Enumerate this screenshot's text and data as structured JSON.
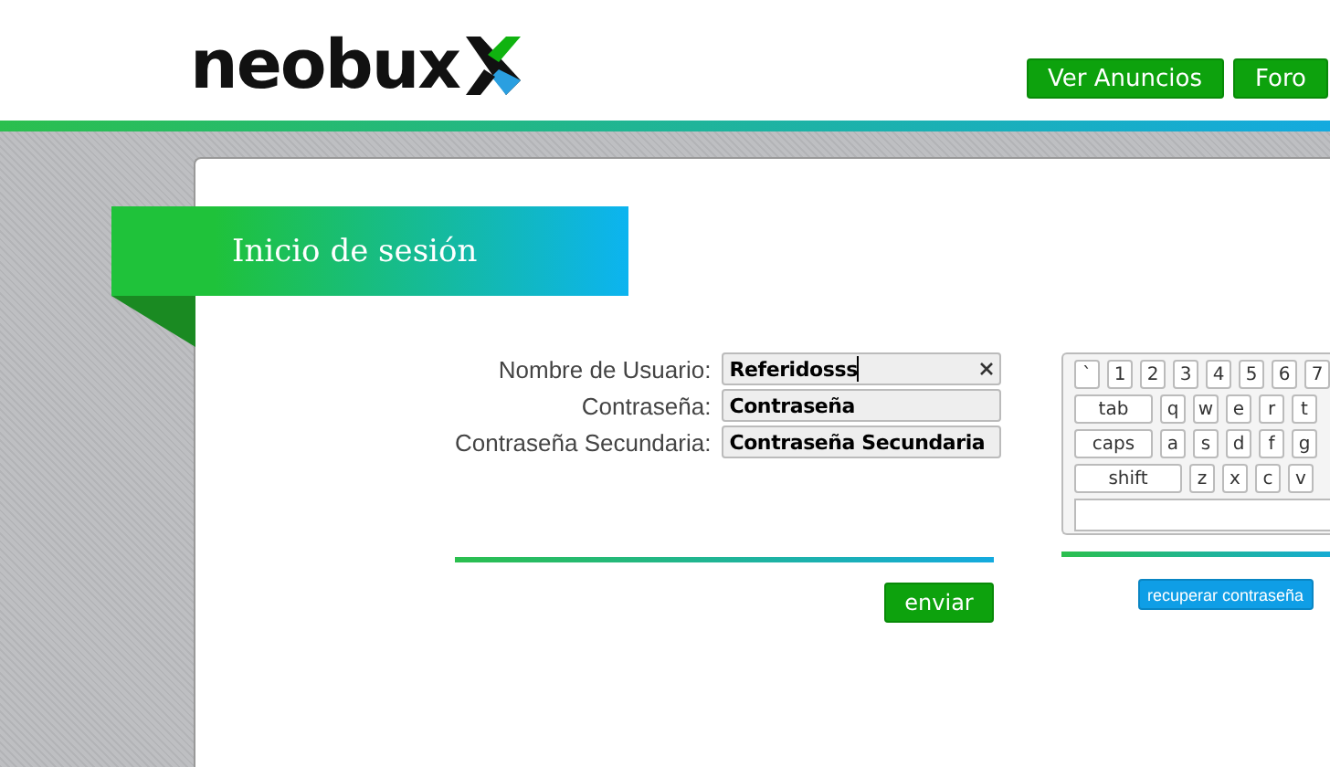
{
  "header": {
    "logo": "neobux",
    "nav": [
      "Ver Anuncios",
      "Foro"
    ]
  },
  "login": {
    "title": "Inicio de sesión",
    "fields": [
      {
        "label": "Nombre de Usuario:",
        "value": "Referidosss",
        "clearable": true
      },
      {
        "label": "Contraseña:",
        "value": "Contraseña",
        "clearable": false
      },
      {
        "label": "Contraseña Secundaria:",
        "value": "Contraseña Secundaria",
        "clearable": false
      }
    ],
    "submit": "enviar"
  },
  "keyboard": {
    "key_rows": [
      [
        {
          "label": "`",
          "kind": "key"
        },
        {
          "label": "1",
          "kind": "key"
        },
        {
          "label": "2",
          "kind": "key"
        },
        {
          "label": "3",
          "kind": "key"
        },
        {
          "label": "4",
          "kind": "key"
        },
        {
          "label": "5",
          "kind": "key"
        },
        {
          "label": "6",
          "kind": "key"
        },
        {
          "label": "7",
          "kind": "key"
        }
      ],
      [
        {
          "label": "tab",
          "kind": "wide"
        },
        {
          "label": "q",
          "kind": "key"
        },
        {
          "label": "w",
          "kind": "key"
        },
        {
          "label": "e",
          "kind": "key"
        },
        {
          "label": "r",
          "kind": "key"
        },
        {
          "label": "t",
          "kind": "key"
        }
      ],
      [
        {
          "label": "caps",
          "kind": "wide"
        },
        {
          "label": "a",
          "kind": "key"
        },
        {
          "label": "s",
          "kind": "key"
        },
        {
          "label": "d",
          "kind": "key"
        },
        {
          "label": "f",
          "kind": "key"
        },
        {
          "label": "g",
          "kind": "key"
        }
      ],
      [
        {
          "label": "shift",
          "kind": "wider"
        },
        {
          "label": "z",
          "kind": "key"
        },
        {
          "label": "x",
          "kind": "key"
        },
        {
          "label": "c",
          "kind": "key"
        },
        {
          "label": "v",
          "kind": "key"
        }
      ]
    ],
    "recover": "recuperar contraseña"
  }
}
